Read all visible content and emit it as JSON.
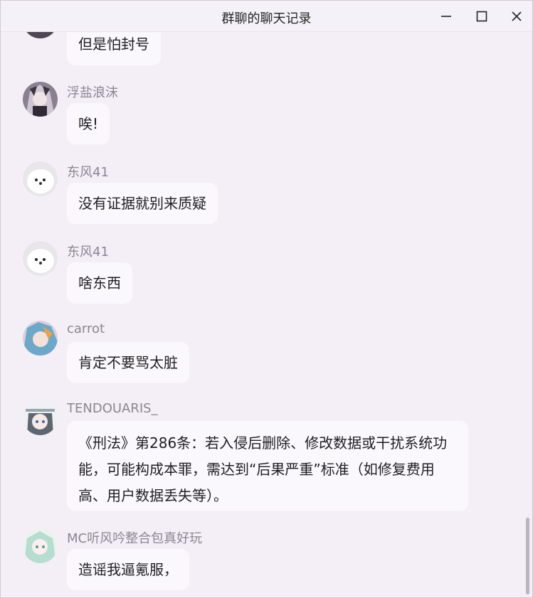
{
  "window": {
    "title": "群聊的聊天记录",
    "minimize_icon": "minimize-icon",
    "maximize_icon": "maximize-icon",
    "close_icon": "close-icon"
  },
  "messages": [
    {
      "sender": "",
      "text": "但是怕封号",
      "avatar_icon": "avatar-dark-icon"
    },
    {
      "sender": "浮盐浪沫",
      "text": "唉!",
      "avatar_icon": "avatar-anime-girl-icon"
    },
    {
      "sender": "东风41",
      "text": "没有证据就别来质疑",
      "avatar_icon": "avatar-white-dog-icon"
    },
    {
      "sender": "东风41",
      "text": "啥东西",
      "avatar_icon": "avatar-white-dog-icon"
    },
    {
      "sender": "carrot",
      "text": "肯定不要骂太脏",
      "avatar_icon": "avatar-anime-blue-icon"
    },
    {
      "sender": "TENDOUARIS_",
      "text": "《刑法》第286条：若入侵后删除、修改数据或干扰系统功能，可能构成本罪，需达到“后果严重”标准（如修复费用高、用户数据丢失等）。",
      "avatar_icon": "avatar-anime-maid-icon"
    },
    {
      "sender": "MC听风吟整合包真好玩",
      "text": "造谣我逼氪服，",
      "avatar_icon": "avatar-anime-green-icon"
    }
  ]
}
